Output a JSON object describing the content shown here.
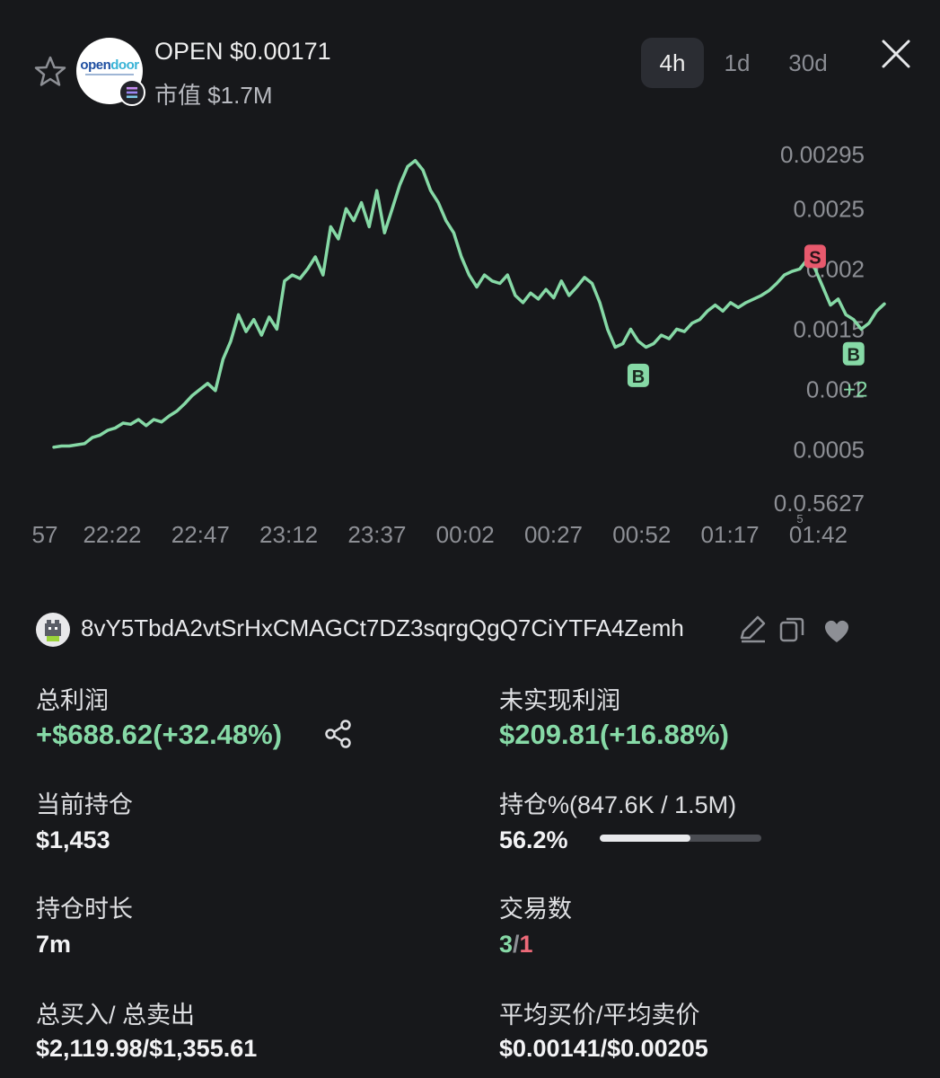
{
  "header": {
    "token_title": "OPEN $0.00171",
    "market_cap": "市值 $1.7M",
    "logo_word_a": "open",
    "logo_word_b": "door",
    "timeframes": [
      "4h",
      "1d",
      "30d"
    ],
    "active_timeframe": "4h"
  },
  "chart_data": {
    "type": "line",
    "title": "",
    "x_ticks": [
      "57",
      "22:22",
      "22:47",
      "23:12",
      "23:37",
      "00:02",
      "00:27",
      "00:52",
      "01:17",
      "01:42"
    ],
    "y_ticks": [
      "0.00295",
      "0.0025",
      "0.002",
      "0.0015",
      "0.001",
      "0.0005",
      "0.0.5627"
    ],
    "y_tick_values": [
      0.00295,
      0.0025,
      0.002,
      0.0015,
      0.001,
      0.0005,
      5.62e-05
    ],
    "ylim": [
      5.62e-05,
      0.00295
    ],
    "tick_subscript": "5",
    "series": [
      {
        "color": "#86d9a6",
        "values": [
          0.00052,
          0.00053,
          0.00053,
          0.00054,
          0.00055,
          0.0006,
          0.00062,
          0.00066,
          0.00068,
          0.00072,
          0.00071,
          0.00075,
          0.0007,
          0.00075,
          0.00073,
          0.00078,
          0.00082,
          0.00088,
          0.00095,
          0.001,
          0.00105,
          0.00099,
          0.00125,
          0.0014,
          0.00162,
          0.00148,
          0.00158,
          0.00145,
          0.0016,
          0.0015,
          0.0019,
          0.00195,
          0.00192,
          0.002,
          0.0021,
          0.00195,
          0.00235,
          0.00225,
          0.0025,
          0.0024,
          0.00255,
          0.00235,
          0.00265,
          0.0023,
          0.0025,
          0.0027,
          0.00285,
          0.0029,
          0.00282,
          0.00265,
          0.00255,
          0.0024,
          0.0023,
          0.0021,
          0.00195,
          0.00185,
          0.00195,
          0.0019,
          0.00188,
          0.00195,
          0.00178,
          0.00172,
          0.0018,
          0.00175,
          0.00183,
          0.00176,
          0.0019,
          0.00178,
          0.00185,
          0.00193,
          0.00188,
          0.00172,
          0.0015,
          0.00135,
          0.00138,
          0.0015,
          0.0014,
          0.00135,
          0.00138,
          0.00145,
          0.00142,
          0.0015,
          0.00148,
          0.00155,
          0.00158,
          0.00165,
          0.0017,
          0.00165,
          0.00172,
          0.00168,
          0.00172,
          0.00175,
          0.00178,
          0.00182,
          0.00188,
          0.00195,
          0.00198,
          0.002,
          0.00208,
          0.002,
          0.00185,
          0.0017,
          0.00175,
          0.00162,
          0.00158,
          0.0015,
          0.00155,
          0.00165,
          0.00171
        ]
      }
    ],
    "markers": [
      {
        "label": "B",
        "kind": "buy",
        "index": 76
      },
      {
        "label": "S",
        "kind": "sell",
        "index": 99
      },
      {
        "label": "B",
        "kind": "buy",
        "index": 104
      }
    ],
    "extra_count": "+2",
    "grid": false
  },
  "wallet": {
    "address": "8vY5TbdA2vtSrHxCMAGCt7DZ3sqrgQgQ7CiYTFA4Zemh"
  },
  "stats": {
    "total_profit_label": "总利润",
    "total_profit_value": "+$688.62(+32.48%)",
    "unrealized_label": "未实现利润",
    "unrealized_value": "$209.81(+16.88%)",
    "position_label": "当前持仓",
    "position_value": "$1,453",
    "holding_pct_label": "持仓%(847.6K / 1.5M)",
    "holding_pct_value": "56.2%",
    "holding_fraction": 0.562,
    "hold_time_label": "持仓时长",
    "hold_time_value": "7m",
    "trades_label": "交易数",
    "trades_buys": "3",
    "trades_sep": "/",
    "trades_sells": "1",
    "buy_sell_total_label": "总买入/ 总卖出",
    "buy_sell_total_value": "$2,119.98/$1,355.61",
    "avg_price_label": "平均买价/平均卖价",
    "avg_price_value": "$0.00141/$0.00205"
  },
  "colors": {
    "background": "#17181b",
    "positive": "#86d9a6",
    "negative": "#ee6a79"
  }
}
